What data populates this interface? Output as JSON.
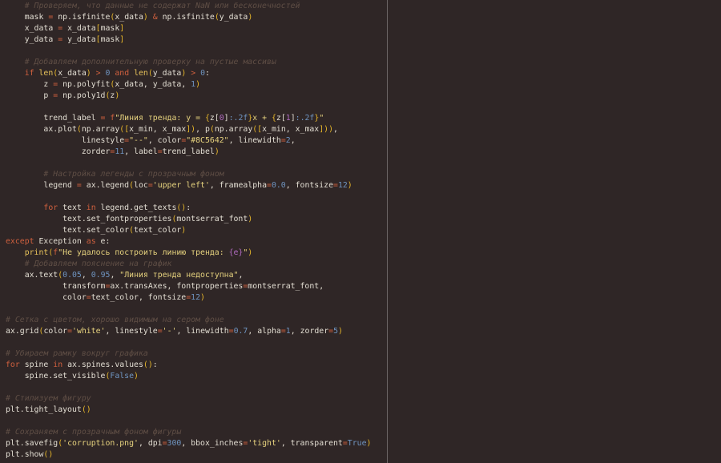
{
  "colors": {
    "background": "#2f2626",
    "comment": "#5f4e45",
    "keyword": "#d0603e",
    "string": "#e6d27e",
    "number": "#6f94c0",
    "bracket": "#e5b52a"
  },
  "lines": [
    {
      "tokens": [
        [
          "c",
          "    # Проверяем, что данные не содержат NaN или бесконечностей"
        ]
      ]
    },
    {
      "tokens": [
        [
          "v",
          "    mask "
        ],
        [
          "o",
          "="
        ],
        [
          "v",
          " np.isfinite"
        ],
        [
          "p",
          "("
        ],
        [
          "v",
          "x_data"
        ],
        [
          "p",
          ")"
        ],
        [
          "o",
          " & "
        ],
        [
          "v",
          "np.isfinite"
        ],
        [
          "p",
          "("
        ],
        [
          "v",
          "y_data"
        ],
        [
          "p",
          ")"
        ]
      ]
    },
    {
      "tokens": [
        [
          "v",
          "    x_data "
        ],
        [
          "o",
          "="
        ],
        [
          "v",
          " x_data"
        ],
        [
          "p",
          "["
        ],
        [
          "v",
          "mask"
        ],
        [
          "p",
          "]"
        ]
      ]
    },
    {
      "tokens": [
        [
          "v",
          "    y_data "
        ],
        [
          "o",
          "="
        ],
        [
          "v",
          " y_data"
        ],
        [
          "p",
          "["
        ],
        [
          "v",
          "mask"
        ],
        [
          "p",
          "]"
        ]
      ]
    },
    {
      "tokens": []
    },
    {
      "tokens": [
        [
          "c",
          "    # Добавляем дополнительную проверку на пустые массивы"
        ]
      ]
    },
    {
      "tokens": [
        [
          "k",
          "    if "
        ],
        [
          "b",
          "len"
        ],
        [
          "p",
          "("
        ],
        [
          "v",
          "x_data"
        ],
        [
          "p",
          ")"
        ],
        [
          "o",
          " > "
        ],
        [
          "n",
          "0"
        ],
        [
          "k",
          " and "
        ],
        [
          "b",
          "len"
        ],
        [
          "p",
          "("
        ],
        [
          "v",
          "y_data"
        ],
        [
          "p",
          ")"
        ],
        [
          "o",
          " > "
        ],
        [
          "n",
          "0"
        ],
        [
          "v",
          ":"
        ]
      ]
    },
    {
      "tokens": [
        [
          "v",
          "        z "
        ],
        [
          "o",
          "="
        ],
        [
          "v",
          " np.polyfit"
        ],
        [
          "p",
          "("
        ],
        [
          "v",
          "x_data, y_data, "
        ],
        [
          "n",
          "1"
        ],
        [
          "p",
          ")"
        ]
      ]
    },
    {
      "tokens": [
        [
          "v",
          "        p "
        ],
        [
          "o",
          "="
        ],
        [
          "v",
          " np.poly1d"
        ],
        [
          "p",
          "("
        ],
        [
          "v",
          "z"
        ],
        [
          "p",
          ")"
        ]
      ]
    },
    {
      "tokens": []
    },
    {
      "tokens": [
        [
          "v",
          "        trend_label "
        ],
        [
          "o",
          "="
        ],
        [
          "k",
          " f"
        ],
        [
          "s",
          "\"Линия тренда: y = "
        ],
        [
          "p",
          "{"
        ],
        [
          "v",
          "z["
        ],
        [
          "i",
          "0"
        ],
        [
          "v",
          "]"
        ],
        [
          "n",
          ":.2f"
        ],
        [
          "p",
          "}"
        ],
        [
          "s",
          "x + "
        ],
        [
          "p",
          "{"
        ],
        [
          "v",
          "z["
        ],
        [
          "i",
          "1"
        ],
        [
          "v",
          "]"
        ],
        [
          "n",
          ":.2f"
        ],
        [
          "p",
          "}"
        ],
        [
          "s",
          "\""
        ]
      ]
    },
    {
      "tokens": [
        [
          "v",
          "        ax.plot"
        ],
        [
          "p",
          "("
        ],
        [
          "v",
          "np.array"
        ],
        [
          "p",
          "(["
        ],
        [
          "v",
          "x_min, x_max"
        ],
        [
          "p",
          "])"
        ],
        [
          "v",
          ", p"
        ],
        [
          "p",
          "("
        ],
        [
          "v",
          "np.array"
        ],
        [
          "p",
          "(["
        ],
        [
          "v",
          "x_min, x_max"
        ],
        [
          "p",
          "]))"
        ],
        [
          "v",
          ","
        ]
      ]
    },
    {
      "tokens": [
        [
          "v",
          "                linestyle"
        ],
        [
          "o",
          "="
        ],
        [
          "s",
          "\"--\""
        ],
        [
          "v",
          ", color"
        ],
        [
          "o",
          "="
        ],
        [
          "s",
          "\"#8C5642\""
        ],
        [
          "v",
          ", linewidth"
        ],
        [
          "o",
          "="
        ],
        [
          "n",
          "2"
        ],
        [
          "v",
          ","
        ]
      ]
    },
    {
      "tokens": [
        [
          "v",
          "                zorder"
        ],
        [
          "o",
          "="
        ],
        [
          "n",
          "11"
        ],
        [
          "v",
          ", label"
        ],
        [
          "o",
          "="
        ],
        [
          "v",
          "trend_label"
        ],
        [
          "p",
          ")"
        ]
      ]
    },
    {
      "tokens": []
    },
    {
      "tokens": [
        [
          "c",
          "        # Настройка легенды с прозрачным фоном"
        ]
      ]
    },
    {
      "tokens": [
        [
          "v",
          "        legend "
        ],
        [
          "o",
          "="
        ],
        [
          "v",
          " ax.legend"
        ],
        [
          "p",
          "("
        ],
        [
          "v",
          "loc"
        ],
        [
          "o",
          "="
        ],
        [
          "s",
          "'upper left'"
        ],
        [
          "v",
          ", framealpha"
        ],
        [
          "o",
          "="
        ],
        [
          "n",
          "0.0"
        ],
        [
          "v",
          ", fontsize"
        ],
        [
          "o",
          "="
        ],
        [
          "n",
          "12"
        ],
        [
          "p",
          ")"
        ]
      ]
    },
    {
      "tokens": []
    },
    {
      "tokens": [
        [
          "k",
          "        for "
        ],
        [
          "v",
          "text "
        ],
        [
          "k",
          "in "
        ],
        [
          "v",
          "legend.get_texts"
        ],
        [
          "p",
          "()"
        ],
        [
          "v",
          ":"
        ]
      ]
    },
    {
      "tokens": [
        [
          "v",
          "            text.set_fontproperties"
        ],
        [
          "p",
          "("
        ],
        [
          "v",
          "montserrat_font"
        ],
        [
          "p",
          ")"
        ]
      ]
    },
    {
      "tokens": [
        [
          "v",
          "            text.set_color"
        ],
        [
          "p",
          "("
        ],
        [
          "v",
          "text_color"
        ],
        [
          "p",
          ")"
        ]
      ]
    },
    {
      "tokens": [
        [
          "k",
          "except "
        ],
        [
          "v",
          "Exception "
        ],
        [
          "k",
          "as "
        ],
        [
          "v",
          "e:"
        ]
      ]
    },
    {
      "tokens": [
        [
          "b",
          "    print"
        ],
        [
          "p",
          "("
        ],
        [
          "k",
          "f"
        ],
        [
          "s",
          "\"Не удалось построить линию тренда: "
        ],
        [
          "i",
          "{e}"
        ],
        [
          "s",
          "\""
        ],
        [
          "p",
          ")"
        ]
      ]
    },
    {
      "tokens": [
        [
          "c",
          "    # Добавляем пояснение на график"
        ]
      ]
    },
    {
      "tokens": [
        [
          "v",
          "    ax.text"
        ],
        [
          "p",
          "("
        ],
        [
          "n",
          "0.05"
        ],
        [
          "v",
          ", "
        ],
        [
          "n",
          "0.95"
        ],
        [
          "v",
          ", "
        ],
        [
          "s",
          "\"Линия тренда недоступна\""
        ],
        [
          "v",
          ","
        ]
      ]
    },
    {
      "tokens": [
        [
          "v",
          "            transform"
        ],
        [
          "o",
          "="
        ],
        [
          "v",
          "ax.transAxes, fontproperties"
        ],
        [
          "o",
          "="
        ],
        [
          "v",
          "montserrat_font,"
        ]
      ]
    },
    {
      "tokens": [
        [
          "v",
          "            color"
        ],
        [
          "o",
          "="
        ],
        [
          "v",
          "text_color, fontsize"
        ],
        [
          "o",
          "="
        ],
        [
          "n",
          "12"
        ],
        [
          "p",
          ")"
        ]
      ]
    },
    {
      "tokens": []
    },
    {
      "tokens": [
        [
          "c",
          "# Сетка с цветом, хорошо видимым на сером фоне"
        ]
      ]
    },
    {
      "tokens": [
        [
          "v",
          "ax.grid"
        ],
        [
          "p",
          "("
        ],
        [
          "v",
          "color"
        ],
        [
          "o",
          "="
        ],
        [
          "s",
          "'white'"
        ],
        [
          "v",
          ", linestyle"
        ],
        [
          "o",
          "="
        ],
        [
          "s",
          "'-'"
        ],
        [
          "v",
          ", linewidth"
        ],
        [
          "o",
          "="
        ],
        [
          "n",
          "0.7"
        ],
        [
          "v",
          ", alpha"
        ],
        [
          "o",
          "="
        ],
        [
          "n",
          "1"
        ],
        [
          "v",
          ", zorder"
        ],
        [
          "o",
          "="
        ],
        [
          "n",
          "5"
        ],
        [
          "p",
          ")"
        ]
      ]
    },
    {
      "tokens": []
    },
    {
      "tokens": [
        [
          "c",
          "# Убираем рамку вокруг графика"
        ]
      ]
    },
    {
      "tokens": [
        [
          "k",
          "for "
        ],
        [
          "v",
          "spine "
        ],
        [
          "k",
          "in "
        ],
        [
          "v",
          "ax.spines.values"
        ],
        [
          "p",
          "()"
        ],
        [
          "v",
          ":"
        ]
      ]
    },
    {
      "tokens": [
        [
          "v",
          "    spine.set_visible"
        ],
        [
          "p",
          "("
        ],
        [
          "n",
          "False"
        ],
        [
          "p",
          ")"
        ]
      ]
    },
    {
      "tokens": []
    },
    {
      "tokens": [
        [
          "c",
          "# Стилизуем фигуру"
        ]
      ]
    },
    {
      "tokens": [
        [
          "v",
          "plt.tight_layout"
        ],
        [
          "p",
          "()"
        ]
      ]
    },
    {
      "tokens": []
    },
    {
      "tokens": [
        [
          "c",
          "# Сохраняем с прозрачным фоном фигуры"
        ]
      ]
    },
    {
      "tokens": [
        [
          "v",
          "plt.savefig"
        ],
        [
          "p",
          "("
        ],
        [
          "s",
          "'corruption.png'"
        ],
        [
          "v",
          ", dpi"
        ],
        [
          "o",
          "="
        ],
        [
          "n",
          "300"
        ],
        [
          "v",
          ", bbox_inches"
        ],
        [
          "o",
          "="
        ],
        [
          "s",
          "'tight'"
        ],
        [
          "v",
          ", transparent"
        ],
        [
          "o",
          "="
        ],
        [
          "n",
          "True"
        ],
        [
          "p",
          ")"
        ]
      ]
    },
    {
      "tokens": [
        [
          "v",
          "plt.show"
        ],
        [
          "p",
          "()"
        ]
      ]
    }
  ]
}
